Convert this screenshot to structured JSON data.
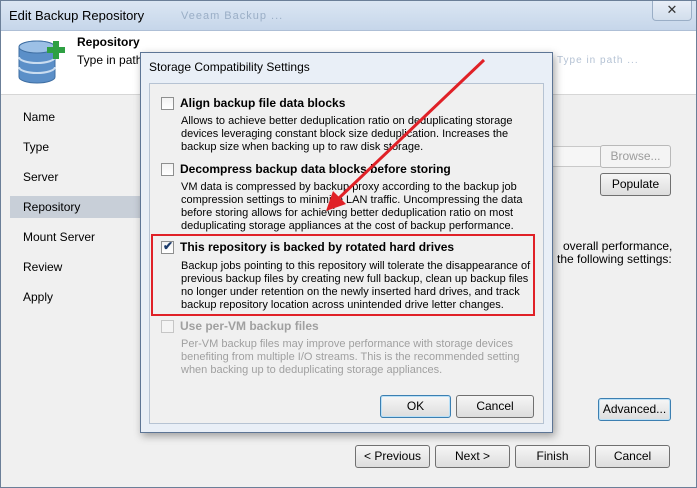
{
  "window": {
    "title": "Edit Backup Repository",
    "title_faded": "Veeam Backup ...",
    "close_glyph": "✕"
  },
  "header": {
    "title": "Repository",
    "description": "Type in path t",
    "faded_text": "Type in path ..."
  },
  "nav": {
    "items": [
      {
        "label": "Name"
      },
      {
        "label": "Type"
      },
      {
        "label": "Server"
      },
      {
        "label": "Repository"
      },
      {
        "label": "Mount Server"
      },
      {
        "label": "Review"
      },
      {
        "label": "Apply"
      }
    ],
    "active_index": 3
  },
  "main": {
    "browse_label": "Browse...",
    "populate_label": "Populate",
    "side_text_1": "overall performance,",
    "side_text_2": "the following settings:",
    "advanced_label": "Advanced..."
  },
  "footer": {
    "previous_label": "< Previous",
    "next_label": "Next >",
    "finish_label": "Finish",
    "cancel_label": "Cancel"
  },
  "dialog": {
    "title": "Storage Compatibility Settings",
    "options": [
      {
        "title": "Align backup file data blocks",
        "checked": false,
        "enabled": true,
        "description_lines": [
          "Allows to achieve better deduplication ratio on deduplicating storage",
          "devices leveraging constant block size deduplication. Increases the",
          "backup size when backing up to raw disk storage."
        ]
      },
      {
        "title": "Decompress backup data blocks before storing",
        "checked": false,
        "enabled": true,
        "description_lines": [
          "VM data is compressed by backup proxy according to the backup job",
          "compression settings to minimize LAN traffic. Uncompressing the data",
          "before storing allows for achieving better deduplication ratio on most",
          "deduplicating storage appliances at the cost of backup performance."
        ]
      },
      {
        "title": "This repository is backed by rotated hard drives",
        "checked": true,
        "enabled": true,
        "description_lines": [
          "Backup jobs pointing to this repository will tolerate the disappearance of",
          "previous backup files by creating new full backup, clean up backup files",
          "no longer under retention on the newly inserted hard drives, and track",
          "backup repository location across unintended drive letter changes."
        ]
      },
      {
        "title": "Use per-VM backup files",
        "checked": false,
        "enabled": false,
        "description_lines": [
          "Per-VM backup files may improve performance with storage devices",
          "benefiting from multiple I/O streams. This is the recommended setting",
          "when backing up to deduplicating storage appliances."
        ]
      }
    ],
    "ok_label": "OK",
    "cancel_label": "Cancel"
  },
  "colors": {
    "annotation": "#e02127",
    "nav_active": "#c8cfd8"
  }
}
